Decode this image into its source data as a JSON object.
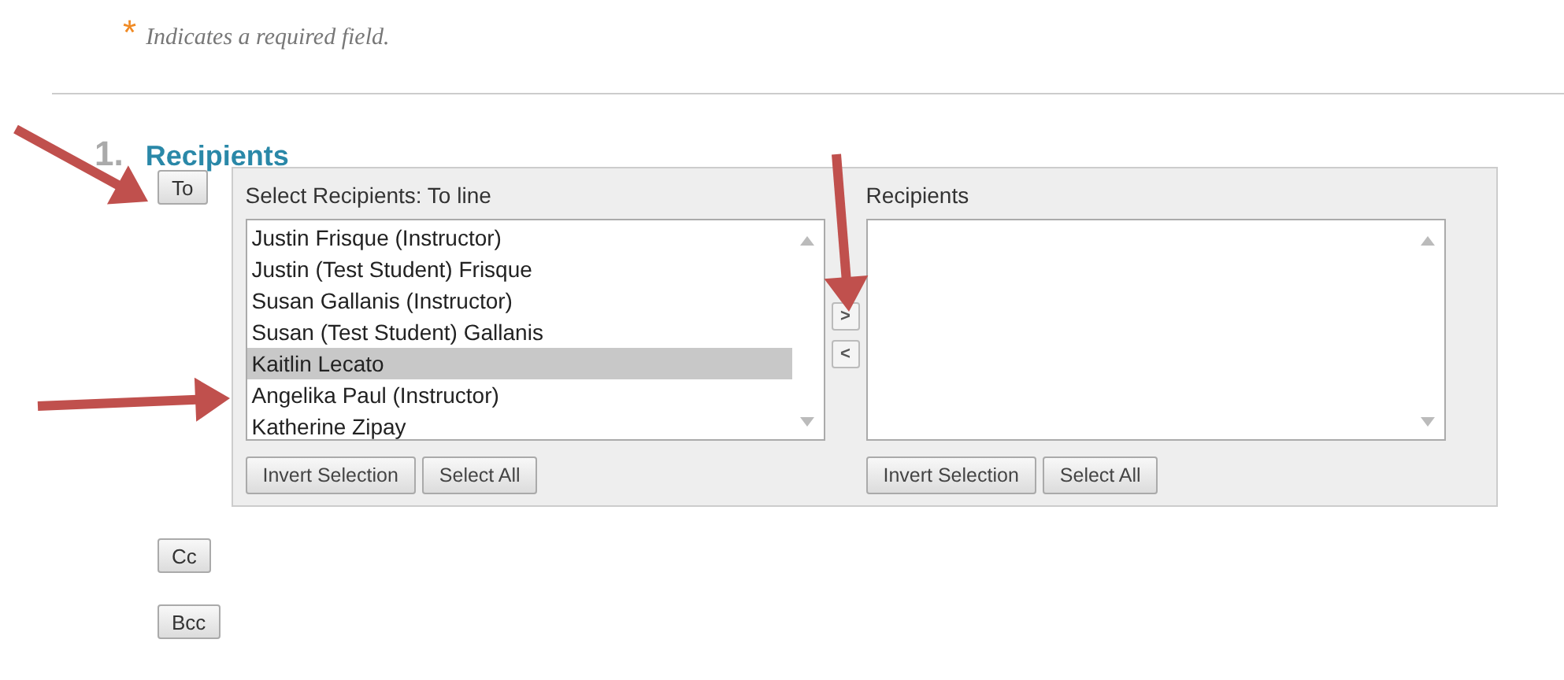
{
  "required_note": {
    "marker": "*",
    "text": "Indicates a required field."
  },
  "section": {
    "number": "1.",
    "title": "Recipients"
  },
  "to_button": "To",
  "picker": {
    "available": {
      "label": "Select Recipients: To line",
      "items": [
        {
          "name": "Justin Frisque (Instructor)",
          "selected": false
        },
        {
          "name": "Justin (Test Student) Frisque",
          "selected": false
        },
        {
          "name": "Susan Gallanis (Instructor)",
          "selected": false
        },
        {
          "name": "Susan (Test Student) Gallanis",
          "selected": false
        },
        {
          "name": "Kaitlin Lecato",
          "selected": true
        },
        {
          "name": "Angelika Paul (Instructor)",
          "selected": false
        },
        {
          "name": "Katherine Zipay",
          "selected": false
        }
      ],
      "buttons": [
        "Invert Selection",
        "Select All"
      ]
    },
    "move_buttons": [
      ">",
      "<"
    ],
    "chosen": {
      "label": "Recipients",
      "buttons": [
        "Invert Selection",
        "Select All"
      ]
    }
  },
  "cc_button": "Cc",
  "bcc_button": "Bcc"
}
